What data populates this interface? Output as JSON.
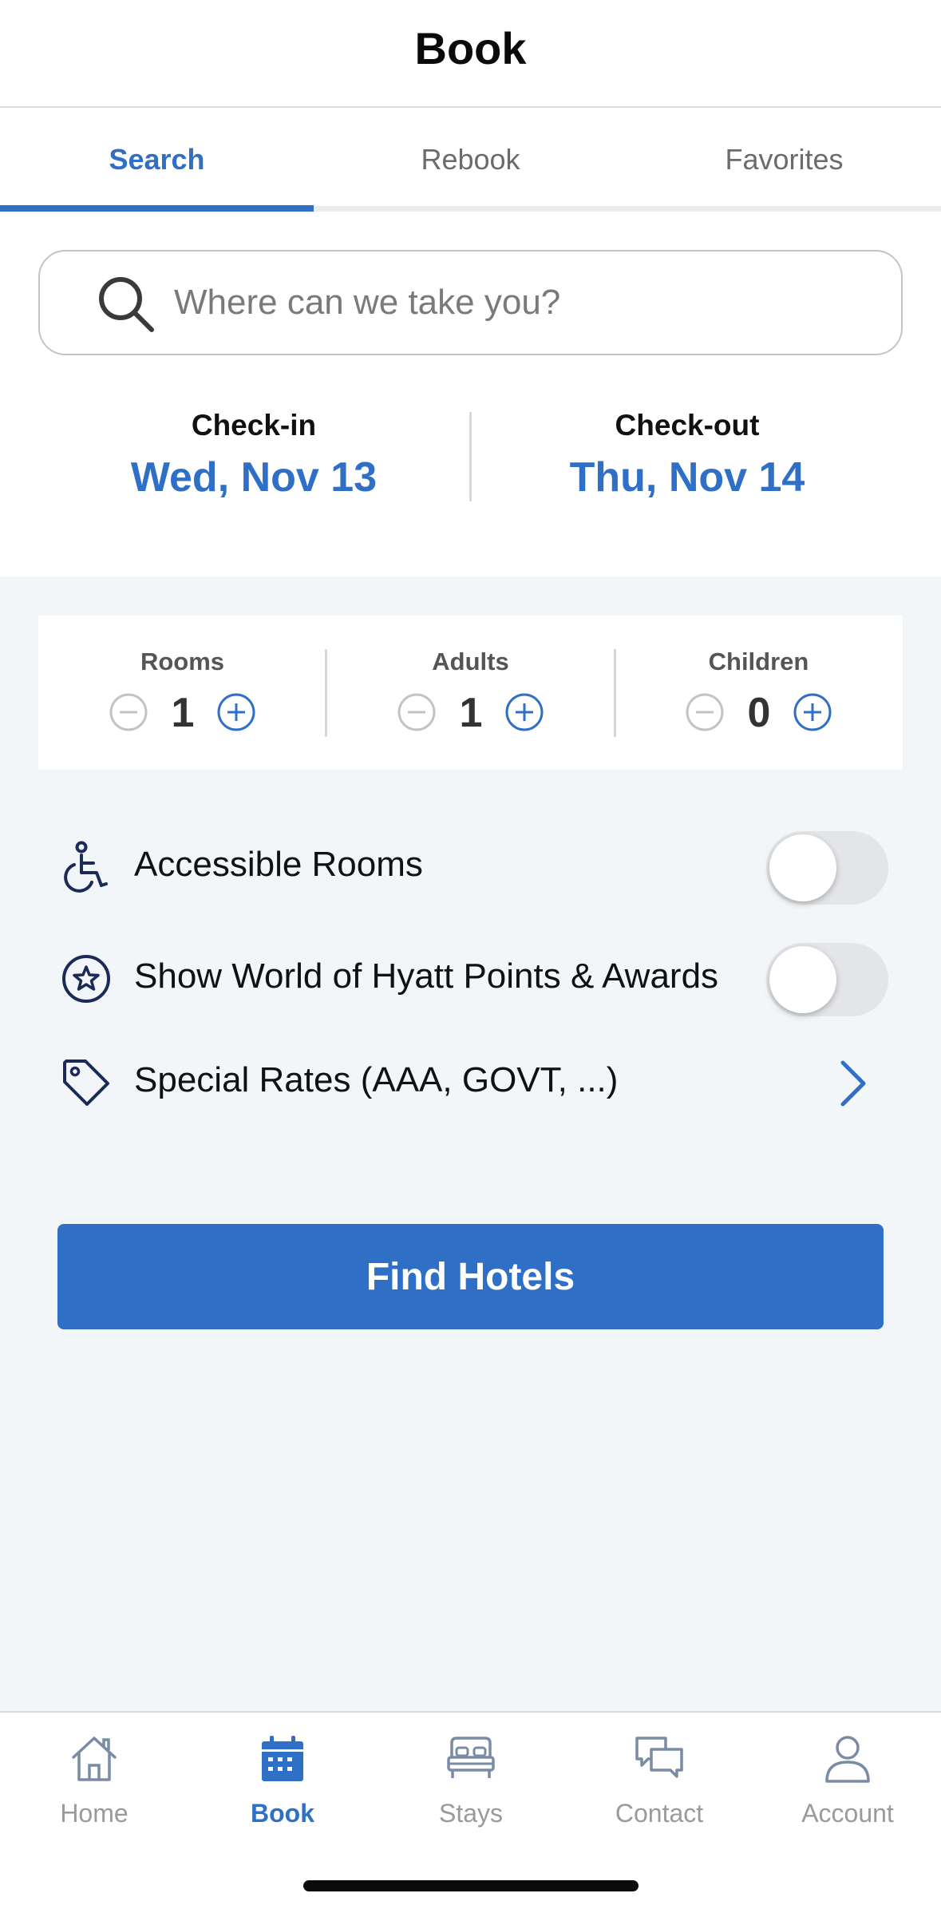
{
  "header": {
    "title": "Book"
  },
  "tabs": [
    {
      "label": "Search",
      "active": true
    },
    {
      "label": "Rebook",
      "active": false
    },
    {
      "label": "Favorites",
      "active": false
    }
  ],
  "search": {
    "placeholder": "Where can we take you?",
    "value": "",
    "icon": "search-icon"
  },
  "dates": {
    "checkin": {
      "label": "Check-in",
      "value": "Wed, Nov 13"
    },
    "checkout": {
      "label": "Check-out",
      "value": "Thu, Nov 14"
    }
  },
  "occupancy": [
    {
      "label": "Rooms",
      "value": "1",
      "minus_enabled": false
    },
    {
      "label": "Adults",
      "value": "1",
      "minus_enabled": false
    },
    {
      "label": "Children",
      "value": "0",
      "minus_enabled": false
    }
  ],
  "options": {
    "accessible": {
      "label": "Accessible Rooms",
      "icon": "wheelchair-icon",
      "on": false
    },
    "points": {
      "label": "Show World of Hyatt Points & Awards",
      "icon": "star-circle-icon",
      "on": false
    },
    "special_rates": {
      "label": "Special Rates (AAA, GOVT, ...)",
      "icon": "tag-icon"
    }
  },
  "cta": {
    "label": "Find Hotels"
  },
  "tabbar": [
    {
      "label": "Home",
      "icon": "home-icon",
      "active": false
    },
    {
      "label": "Book",
      "icon": "calendar-icon",
      "active": true
    },
    {
      "label": "Stays",
      "icon": "bed-icon",
      "active": false
    },
    {
      "label": "Contact",
      "icon": "chat-icon",
      "active": false
    },
    {
      "label": "Account",
      "icon": "person-icon",
      "active": false
    }
  ],
  "colors": {
    "accent": "#2f6fc6",
    "navy_icon": "#1b2a57",
    "background": "#f2f6f9"
  }
}
